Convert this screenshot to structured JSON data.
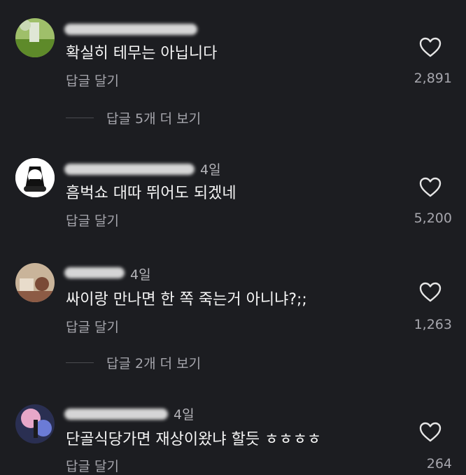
{
  "comments": [
    {
      "time": "",
      "text": "확실히 테무는 아닙니다",
      "reply_label": "답글 달기",
      "likes": "2,891",
      "more_replies": "답글 5개 더 보기"
    },
    {
      "time": "4일",
      "text": "흠벅쇼 대따 뛰어도 되겠네",
      "reply_label": "답글 달기",
      "likes": "5,200",
      "more_replies": ""
    },
    {
      "time": "4일",
      "text": "싸이랑 만나면 한 쪽 죽는거 아니냐?;;",
      "reply_label": "답글 달기",
      "likes": "1,263",
      "more_replies": "답글 2개 더 보기"
    },
    {
      "time": "4일",
      "text": "단골식당가면 재상이왔냐 할듯 ㅎㅎㅎㅎ",
      "reply_label": "답글 달기",
      "likes": "264",
      "more_replies": ""
    }
  ],
  "icons": {
    "like": "heart-icon"
  },
  "colors": {
    "background": "#1c1d21",
    "text": "#f5f5f5",
    "muted": "#a6a6ad"
  }
}
